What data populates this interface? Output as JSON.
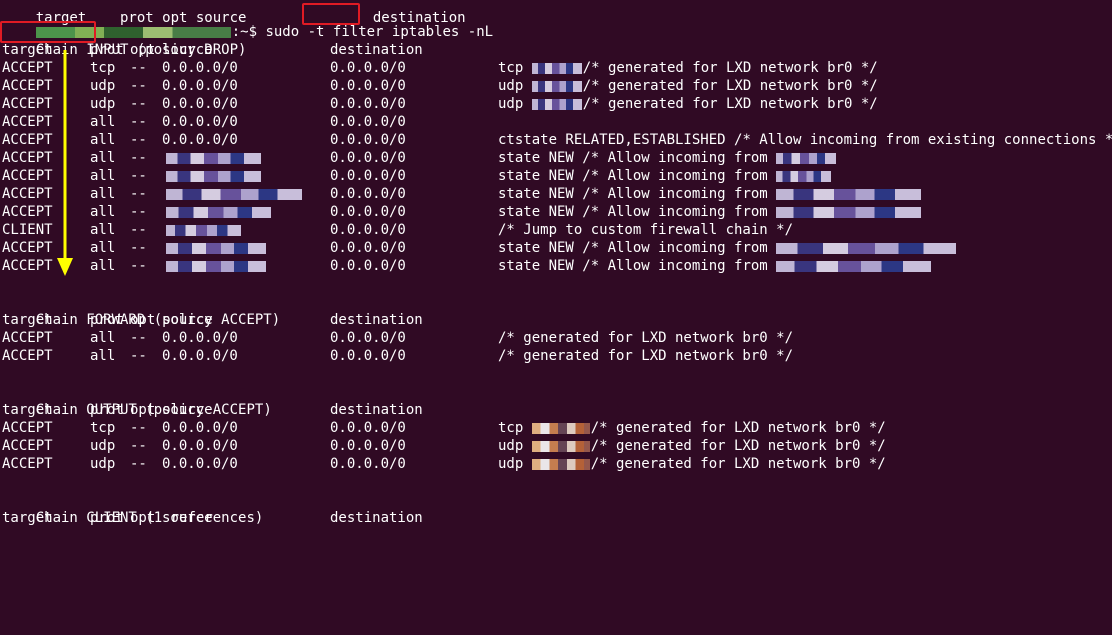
{
  "prompt": {
    "header_fragment": "target    prot opt source               destination",
    "symbol": ":~$",
    "command_parts": [
      "sudo -t",
      "filter",
      "iptables -nL"
    ]
  },
  "chains": [
    {
      "title": "Chain INPUT",
      "policy": "(policy DROP)",
      "headers": [
        "target",
        "prot",
        "opt",
        "source",
        "destination"
      ],
      "rows": [
        {
          "target": "ACCEPT",
          "prot": "tcp",
          "opt": "--",
          "source": "0.0.0.0/0",
          "destination": "0.0.0.0/0",
          "extra": "tcp ",
          "comment": "/* generated for LXD network br0 */"
        },
        {
          "target": "ACCEPT",
          "prot": "udp",
          "opt": "--",
          "source": "0.0.0.0/0",
          "destination": "0.0.0.0/0",
          "extra": "udp ",
          "comment": "/* generated for LXD network br0 */"
        },
        {
          "target": "ACCEPT",
          "prot": "udp",
          "opt": "--",
          "source": "0.0.0.0/0",
          "destination": "0.0.0.0/0",
          "extra": "udp ",
          "comment": "/* generated for LXD network br0 */"
        },
        {
          "target": "ACCEPT",
          "prot": "all",
          "opt": "--",
          "source": "0.0.0.0/0",
          "destination": "0.0.0.0/0",
          "extra": "",
          "comment": ""
        },
        {
          "target": "ACCEPT",
          "prot": "all",
          "opt": "--",
          "source": "0.0.0.0/0",
          "destination": "0.0.0.0/0",
          "extra": "ctstate RELATED,ESTABLISHED ",
          "comment": "/* Allow incoming from existing connections */"
        },
        {
          "target": "ACCEPT",
          "prot": "all",
          "opt": "--",
          "source": "",
          "destination": "0.0.0.0/0",
          "extra": "state NEW ",
          "comment": "/* Allow incoming from"
        },
        {
          "target": "ACCEPT",
          "prot": "all",
          "opt": "--",
          "source": "",
          "destination": "0.0.0.0/0",
          "extra": "state NEW ",
          "comment": "/* Allow incoming from"
        },
        {
          "target": "ACCEPT",
          "prot": "all",
          "opt": "--",
          "source": "",
          "destination": "0.0.0.0/0",
          "extra": "state NEW ",
          "comment": "/* Allow incoming from"
        },
        {
          "target": "ACCEPT",
          "prot": "all",
          "opt": "--",
          "source": "",
          "destination": "0.0.0.0/0",
          "extra": "state NEW ",
          "comment": "/* Allow incoming from"
        },
        {
          "target": "CLIENT",
          "prot": "all",
          "opt": "--",
          "source": "",
          "destination": "0.0.0.0/0",
          "extra": "",
          "comment": "/* Jump to custom firewall chain */"
        },
        {
          "target": "ACCEPT",
          "prot": "all",
          "opt": "--",
          "source": "",
          "destination": "0.0.0.0/0",
          "extra": "state NEW ",
          "comment": "/* Allow incoming from"
        },
        {
          "target": "ACCEPT",
          "prot": "all",
          "opt": "--",
          "source": "",
          "destination": "0.0.0.0/0",
          "extra": "state NEW ",
          "comment": "/* Allow incoming from"
        }
      ]
    },
    {
      "title": "Chain FORWARD",
      "policy": "(policy ACCEPT)",
      "headers": [
        "target",
        "prot",
        "opt",
        "source",
        "destination"
      ],
      "rows": [
        {
          "target": "ACCEPT",
          "prot": "all",
          "opt": "--",
          "source": "0.0.0.0/0",
          "destination": "0.0.0.0/0",
          "extra": "",
          "comment": "/* generated for LXD network br0 */"
        },
        {
          "target": "ACCEPT",
          "prot": "all",
          "opt": "--",
          "source": "0.0.0.0/0",
          "destination": "0.0.0.0/0",
          "extra": "",
          "comment": "/* generated for LXD network br0 */"
        }
      ]
    },
    {
      "title": "Chain OUTPUT",
      "policy": "(policy ACCEPT)",
      "headers": [
        "target",
        "prot",
        "opt",
        "source",
        "destination"
      ],
      "rows": [
        {
          "target": "ACCEPT",
          "prot": "tcp",
          "opt": "--",
          "source": "0.0.0.0/0",
          "destination": "0.0.0.0/0",
          "extra": "tcp ",
          "comment": "/* generated for LXD network br0 */"
        },
        {
          "target": "ACCEPT",
          "prot": "udp",
          "opt": "--",
          "source": "0.0.0.0/0",
          "destination": "0.0.0.0/0",
          "extra": "udp ",
          "comment": "/* generated for LXD network br0 */"
        },
        {
          "target": "ACCEPT",
          "prot": "udp",
          "opt": "--",
          "source": "0.0.0.0/0",
          "destination": "0.0.0.0/0",
          "extra": "udp ",
          "comment": "/* generated for LXD network br0 */"
        }
      ]
    },
    {
      "title": "Chain CLIENT",
      "policy": "(1 references)",
      "headers": [
        "target",
        "prot",
        "opt",
        "source",
        "destination"
      ],
      "rows": []
    }
  ],
  "colors": {
    "background": "#300a24",
    "text": "#ffffff",
    "highlight_box": "#e01b24",
    "arrow": "#ffff00"
  }
}
